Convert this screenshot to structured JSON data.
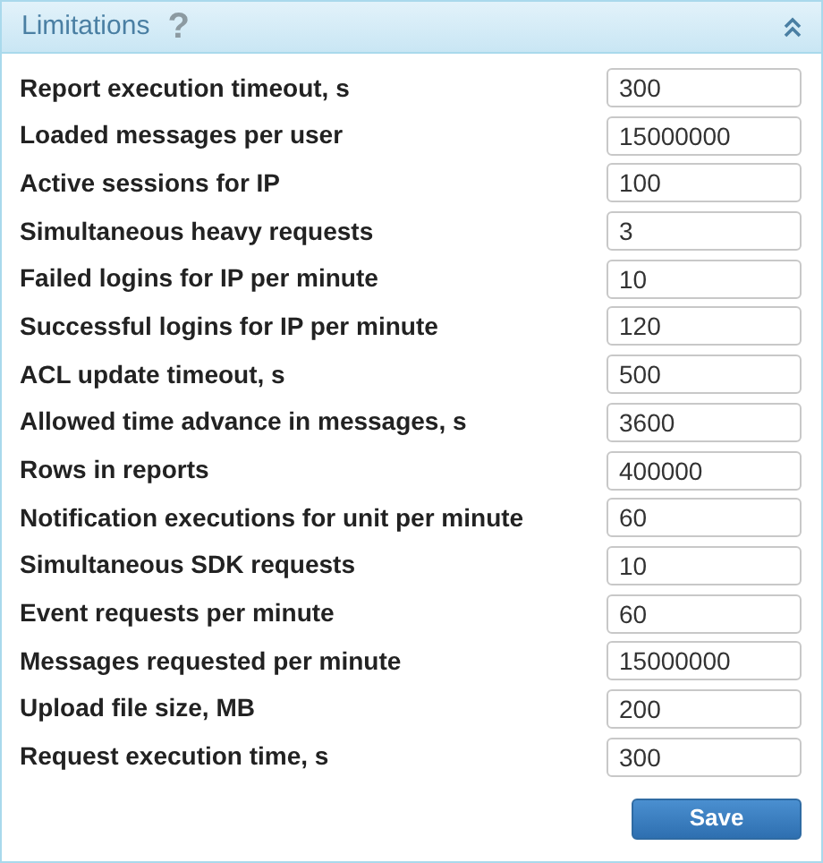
{
  "panel": {
    "title": "Limitations",
    "help": "?",
    "expanded": true
  },
  "fields": [
    {
      "label": "Report execution timeout, s",
      "value": "300"
    },
    {
      "label": "Loaded messages per user",
      "value": "15000000"
    },
    {
      "label": "Active sessions for IP",
      "value": "100"
    },
    {
      "label": "Simultaneous heavy requests",
      "value": "3"
    },
    {
      "label": "Failed logins for IP per minute",
      "value": "10"
    },
    {
      "label": "Successful logins for IP per minute",
      "value": "120"
    },
    {
      "label": "ACL update timeout, s",
      "value": "500"
    },
    {
      "label": "Allowed time advance in messages, s",
      "value": "3600"
    },
    {
      "label": "Rows in reports",
      "value": "400000"
    },
    {
      "label": "Notification executions for unit per minute",
      "value": "60"
    },
    {
      "label": "Simultaneous SDK requests",
      "value": "10"
    },
    {
      "label": "Event requests per minute",
      "value": "60"
    },
    {
      "label": "Messages requested per minute",
      "value": "15000000"
    },
    {
      "label": "Upload file size, MB",
      "value": "200"
    },
    {
      "label": "Request execution time, s",
      "value": "300"
    }
  ],
  "buttons": [
    "Save"
  ]
}
